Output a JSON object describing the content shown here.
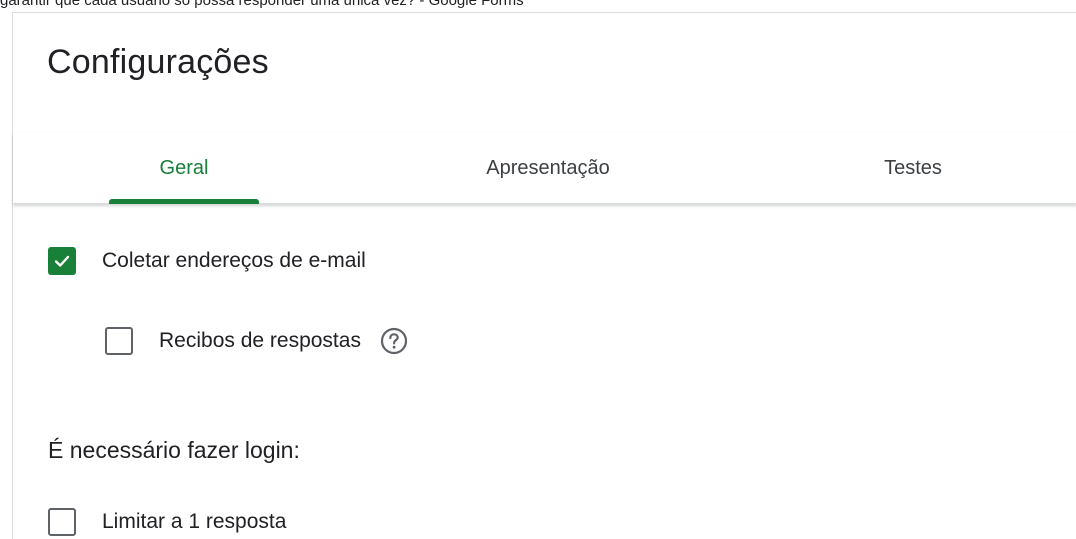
{
  "top_partial_text": "garantir que cada usuário só possa responder uma única vez? - Google Forms",
  "dialog": {
    "title": "Configurações"
  },
  "tabs": [
    {
      "label": "Geral",
      "active": true
    },
    {
      "label": "Apresentação",
      "active": false
    },
    {
      "label": "Testes",
      "active": false
    }
  ],
  "options": {
    "collect_emails": {
      "label": "Coletar endereços de e-mail",
      "checked": true
    },
    "response_receipts": {
      "label": "Recibos de respostas",
      "checked": false,
      "help_icon": "help-circle-icon"
    },
    "login_heading": "É necessário fazer login:",
    "limit_one_response": {
      "label": "Limitar a 1 resposta",
      "checked": false
    }
  },
  "colors": {
    "accent": "#188038",
    "text": "#202124",
    "divider": "#dadce0",
    "checkbox_border": "#5f6368"
  }
}
